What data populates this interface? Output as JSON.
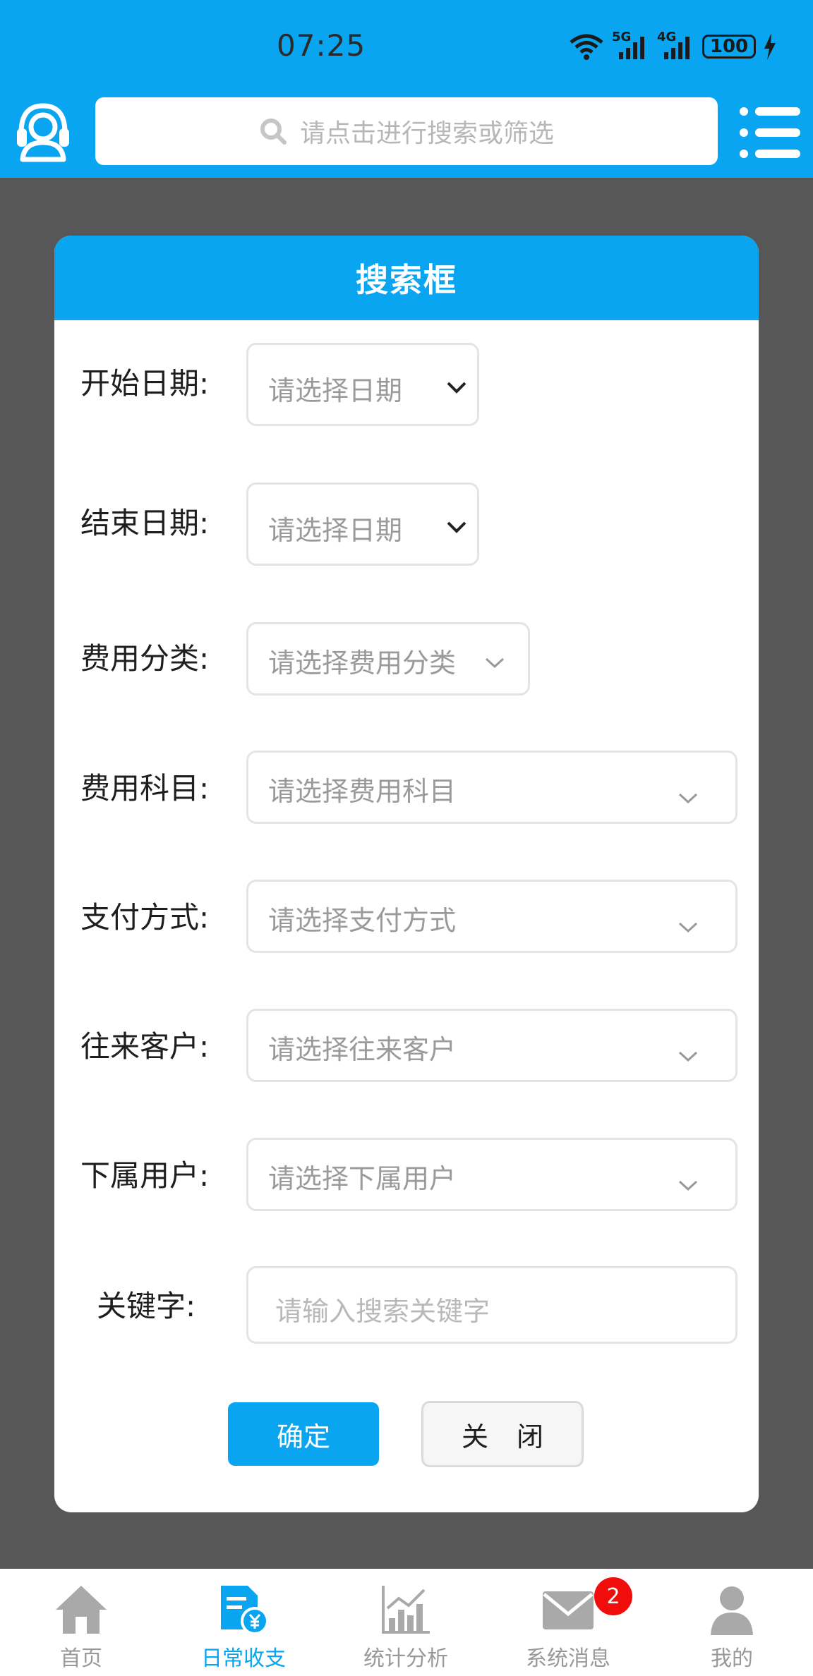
{
  "status_bar": {
    "time": "07:25",
    "battery": "100",
    "signal_1": "5G",
    "signal_2": "4G"
  },
  "header": {
    "search_placeholder": "请点击进行搜索或筛选"
  },
  "modal": {
    "title": "搜索框",
    "fields": [
      {
        "label": "开始日期:",
        "placeholder": "请选择日期"
      },
      {
        "label": "结束日期:",
        "placeholder": "请选择日期"
      },
      {
        "label": "费用分类:",
        "placeholder": "请选择费用分类"
      },
      {
        "label": "费用科目:",
        "placeholder": "请选择费用科目"
      },
      {
        "label": "支付方式:",
        "placeholder": "请选择支付方式"
      },
      {
        "label": "往来客户:",
        "placeholder": "请选择往来客户"
      },
      {
        "label": "下属用户:",
        "placeholder": "请选择下属用户"
      },
      {
        "label": "关键字:",
        "placeholder": "请输入搜索关键字"
      }
    ],
    "confirm_label": "确定",
    "close_label": "关 闭"
  },
  "tabs": [
    {
      "label": "首页",
      "active": false
    },
    {
      "label": "日常收支",
      "active": true
    },
    {
      "label": "统计分析",
      "active": false
    },
    {
      "label": "系统消息",
      "active": false,
      "badge": "2"
    },
    {
      "label": "我的",
      "active": false
    }
  ],
  "colors": {
    "primary": "#0aa5f0",
    "overlay": "#575757",
    "badge": "#f20d0d"
  }
}
